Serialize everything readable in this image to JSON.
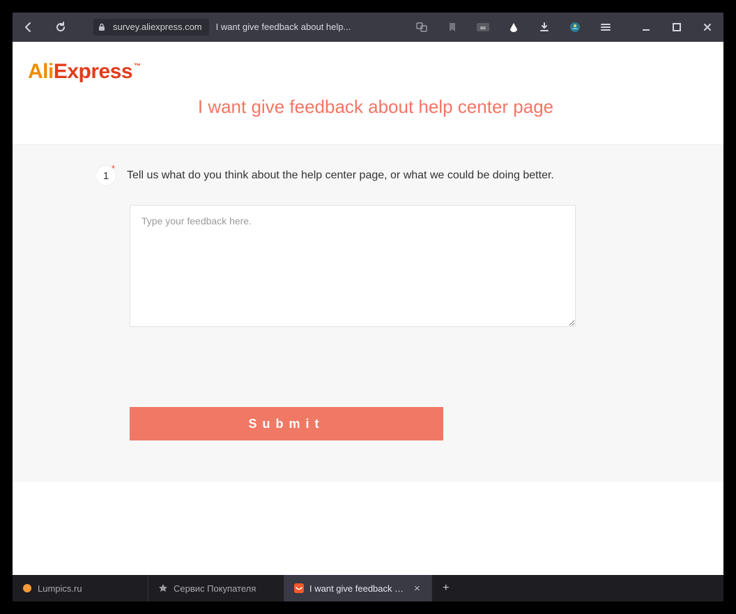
{
  "browser": {
    "domain": "survey.aliexpress.com",
    "title_truncated": "I want give feedback about help..."
  },
  "logo": {
    "part1": "Ali",
    "part2": "Express",
    "tm": "™"
  },
  "page": {
    "title": "I want give feedback about help center page"
  },
  "question": {
    "number": "1",
    "required_mark": "*",
    "text": "Tell us what do you think about the help center page, or what we could be doing better.",
    "placeholder": "Type your feedback here."
  },
  "actions": {
    "submit_label": "Submit"
  },
  "tabs": {
    "t1": {
      "label": "Lumpics.ru"
    },
    "t2": {
      "label": "Сервис Покупателя"
    },
    "t3": {
      "label": "I want give feedback abo",
      "close": "×"
    },
    "newtab": "+"
  }
}
